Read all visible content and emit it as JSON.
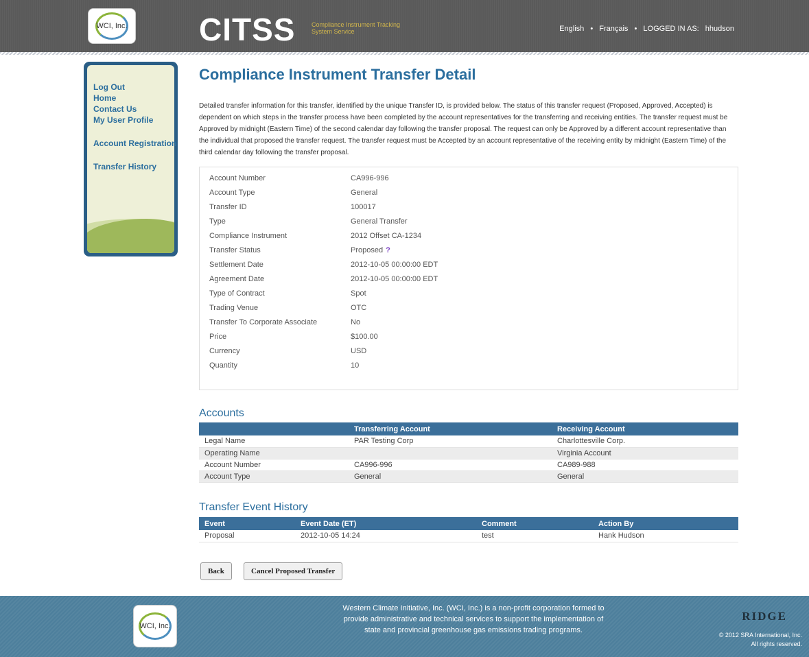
{
  "header": {
    "logo_text": "WCI, Inc.",
    "brand": "CITSS",
    "brand_subtitle": "Compliance Instrument Tracking System Service",
    "lang_english": "English",
    "separator": "•",
    "lang_french": "Français",
    "logged_in_label": "LOGGED IN AS:",
    "username": "hhudson"
  },
  "sidebar": {
    "items": [
      {
        "label": "Log Out"
      },
      {
        "label": "Home"
      },
      {
        "label": "Contact Us"
      },
      {
        "label": "My User Profile"
      },
      {
        "label": "Account Registration"
      },
      {
        "label": "Transfer History"
      }
    ]
  },
  "main": {
    "title": "Compliance Instrument Transfer Detail",
    "intro": "Detailed transfer information for this transfer, identified by the unique Transfer ID, is provided below. The status of this transfer request (Proposed, Approved, Accepted) is dependent on which steps in the transfer process have been completed by the account representatives for the transferring and receiving entities. The transfer request must be Approved by midnight (Eastern Time) of the second calendar day following the transfer proposal. The request can only be Approved by a different account representative than the individual that proposed the transfer request. The transfer request must be Accepted by an account representative of the receiving entity by midnight (Eastern Time) of the third calendar day following the transfer proposal.",
    "details": [
      {
        "label": "Account Number",
        "value": "CA996-996"
      },
      {
        "label": "Account Type",
        "value": "General"
      },
      {
        "label": "Transfer ID",
        "value": "100017"
      },
      {
        "label": "Type",
        "value": "General Transfer"
      },
      {
        "label": "Compliance Instrument",
        "value": "2012 Offset  CA-1234"
      },
      {
        "label": "Transfer Status",
        "value": "Proposed"
      },
      {
        "label": "Settlement Date",
        "value": "2012-10-05 00:00:00 EDT"
      },
      {
        "label": "Agreement Date",
        "value": "2012-10-05 00:00:00 EDT"
      },
      {
        "label": "Type of Contract",
        "value": "Spot"
      },
      {
        "label": "Trading Venue",
        "value": "OTC"
      },
      {
        "label": "Transfer To Corporate Associate",
        "value": "No"
      },
      {
        "label": "Price",
        "value": "$100.00"
      },
      {
        "label": "Currency",
        "value": "USD"
      },
      {
        "label": "Quantity",
        "value": "10"
      }
    ],
    "status_help": "?",
    "accounts": {
      "title": "Accounts",
      "headers": [
        "",
        "Transferring Account",
        "Receiving Account"
      ],
      "rows": [
        [
          "Legal Name",
          "PAR Testing Corp",
          "Charlottesville Corp."
        ],
        [
          "Operating Name",
          "",
          "Virginia Account"
        ],
        [
          "Account Number",
          "CA996-996",
          "CA989-988"
        ],
        [
          "Account Type",
          "General",
          "General"
        ]
      ]
    },
    "history": {
      "title": "Transfer Event History",
      "headers": [
        "Event",
        "Event Date (ET)",
        "Comment",
        "Action By"
      ],
      "rows": [
        [
          "Proposal",
          "2012-10-05 14:24",
          "test",
          "Hank Hudson"
        ]
      ]
    },
    "buttons": {
      "back": "Back",
      "cancel": "Cancel Proposed Transfer"
    }
  },
  "footer": {
    "logo_text": "WCI, Inc.",
    "text": "Western Climate Initiative, Inc. (WCI, Inc.) is a non-profit corporation formed to provide administrative and technical services to support the implementation of state and provincial greenhouse gas emissions trading programs.",
    "ridge": "RIDGE",
    "copyright_line1": "© 2012 SRA International, Inc.",
    "copyright_line2": "All rights reserved."
  }
}
